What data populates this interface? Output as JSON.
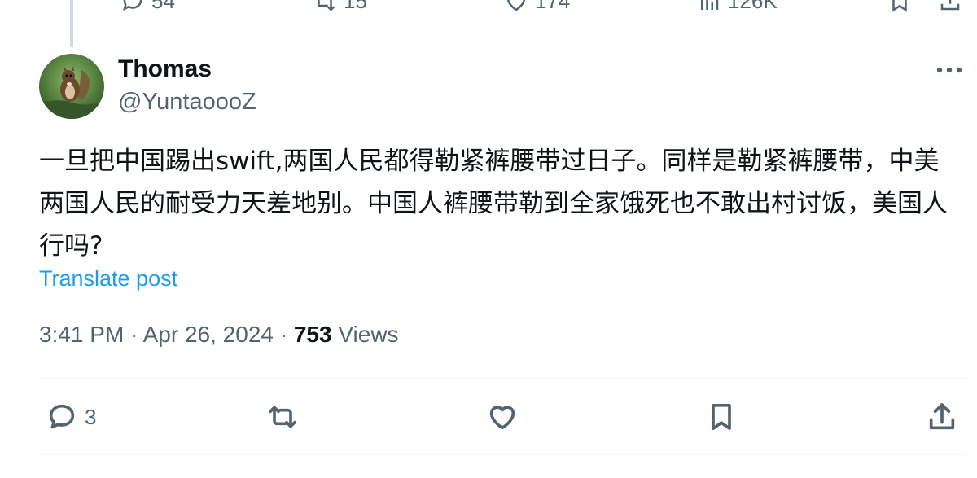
{
  "prev_actions": {
    "replies": "54",
    "reposts": "15",
    "likes": "174",
    "views": "126K"
  },
  "author": {
    "display_name": "Thomas",
    "handle": "@YuntaoooZ"
  },
  "post": {
    "text": "一旦把中国踢出swift,两国人民都得勒紧裤腰带过日子。同样是勒紧裤腰带，中美两国人民的耐受力天差地别。中国人裤腰带勒到全家饿死也不敢出村讨饭，美国人行吗?",
    "translate_label": "Translate post",
    "time": "3:41 PM",
    "date": "Apr 26, 2024",
    "views_count": "753",
    "views_label": "Views"
  },
  "actions": {
    "reply_count": "3",
    "icons": [
      "reply-icon",
      "repost-icon",
      "like-icon",
      "bookmark-icon",
      "share-icon"
    ]
  },
  "colors": {
    "link": "#1d9bf0",
    "secondary_text": "#536471",
    "primary_text": "#0f1419",
    "divider": "#eff3f4"
  }
}
